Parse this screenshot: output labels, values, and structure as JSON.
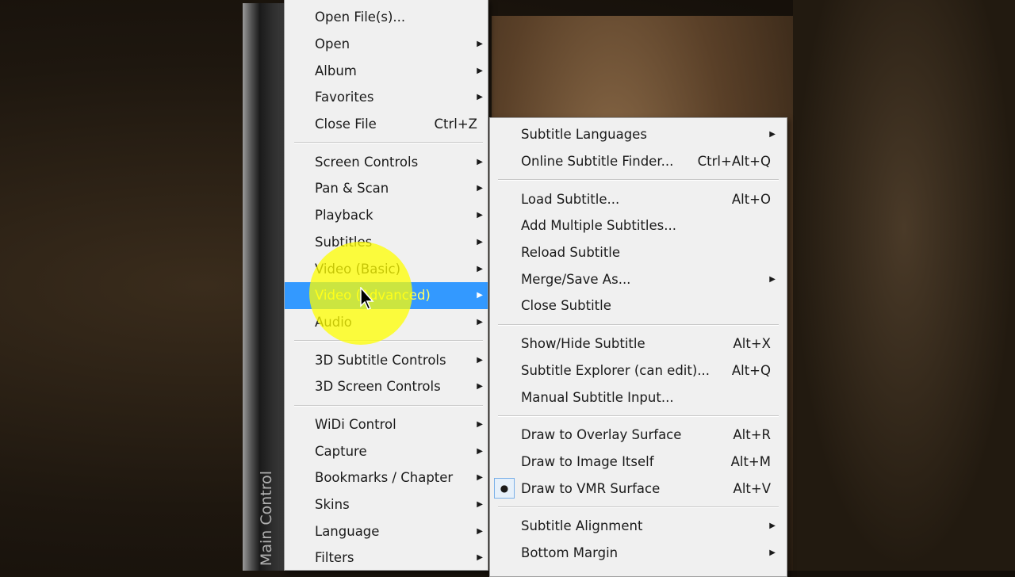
{
  "sidebar": {
    "label": "Main Control"
  },
  "main_menu": [
    {
      "label": "Open File(s)..."
    },
    {
      "label": "Open",
      "submenu": true
    },
    {
      "label": "Album",
      "submenu": true
    },
    {
      "label": "Favorites",
      "submenu": true
    },
    {
      "label": "Close File",
      "shortcut": "Ctrl+Z"
    },
    {
      "separator": true
    },
    {
      "label": "Screen Controls",
      "submenu": true
    },
    {
      "label": "Pan & Scan",
      "submenu": true
    },
    {
      "label": "Playback",
      "submenu": true
    },
    {
      "label": "Subtitles",
      "submenu": true
    },
    {
      "label": "Video (Basic)",
      "submenu": true
    },
    {
      "label": "Video (Advanced)",
      "submenu": true,
      "highlighted": true
    },
    {
      "label": "Audio",
      "submenu": true
    },
    {
      "separator": true
    },
    {
      "label": "3D Subtitle Controls",
      "submenu": true
    },
    {
      "label": "3D Screen Controls",
      "submenu": true
    },
    {
      "separator": true
    },
    {
      "label": "WiDi Control",
      "submenu": true
    },
    {
      "label": "Capture",
      "submenu": true
    },
    {
      "label": "Bookmarks / Chapter",
      "submenu": true
    },
    {
      "label": "Skins",
      "submenu": true
    },
    {
      "label": "Language",
      "submenu": true
    },
    {
      "label": "Filters",
      "submenu": true
    }
  ],
  "sub_menu": [
    {
      "label": "Subtitle Languages",
      "submenu": true
    },
    {
      "label": "Online Subtitle Finder...",
      "shortcut": "Ctrl+Alt+Q"
    },
    {
      "separator": true
    },
    {
      "label": "Load Subtitle...",
      "shortcut": "Alt+O"
    },
    {
      "label": "Add Multiple Subtitles..."
    },
    {
      "label": "Reload Subtitle"
    },
    {
      "label": "Merge/Save As...",
      "submenu": true
    },
    {
      "label": "Close Subtitle"
    },
    {
      "separator": true
    },
    {
      "label": "Show/Hide Subtitle",
      "shortcut": "Alt+X"
    },
    {
      "label": "Subtitle Explorer (can edit)...",
      "shortcut": "Alt+Q"
    },
    {
      "label": "Manual Subtitle Input..."
    },
    {
      "separator": true
    },
    {
      "label": "Draw to Overlay Surface",
      "shortcut": "Alt+R"
    },
    {
      "label": "Draw to Image Itself",
      "shortcut": "Alt+M"
    },
    {
      "label": "Draw to VMR Surface",
      "shortcut": "Alt+V",
      "checked": true
    },
    {
      "separator": true
    },
    {
      "label": "Subtitle Alignment",
      "submenu": true
    },
    {
      "label": "Bottom Margin",
      "submenu": true
    }
  ],
  "colors": {
    "highlight": "#3399ff",
    "highlight_text": "#ffff66"
  }
}
